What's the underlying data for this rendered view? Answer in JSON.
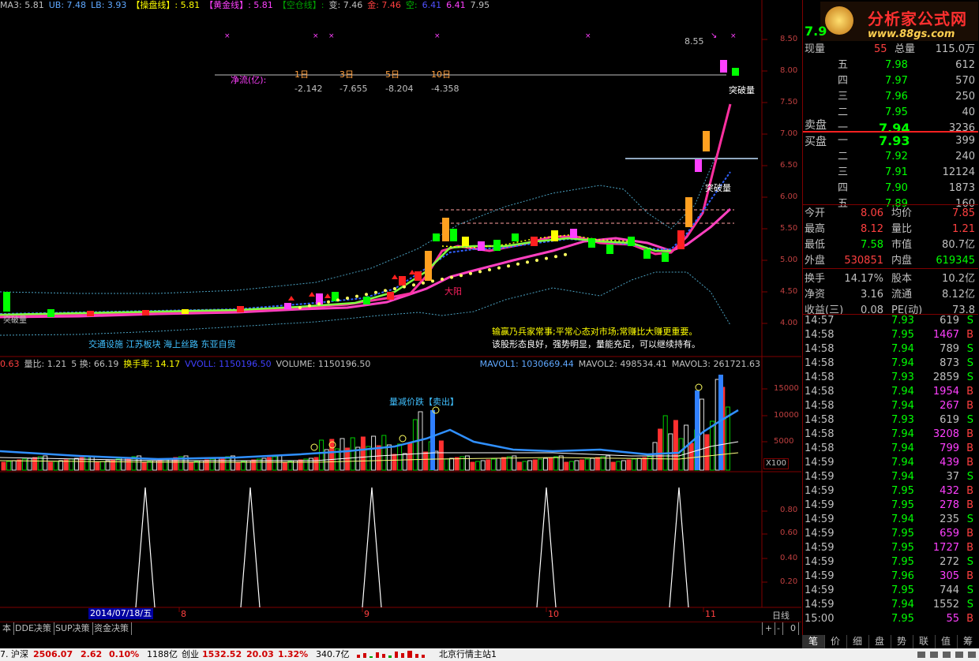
{
  "indicator_legend": [
    {
      "text": "MA3: 5.81",
      "color": "#c0c0c0"
    },
    {
      "text": "UB: 7.48",
      "color": "#5fa8ff"
    },
    {
      "text": "LB: 3.93",
      "color": "#5fa8ff"
    },
    {
      "text": "【操盘线】: 5.81",
      "color": "#ffff00"
    },
    {
      "text": "【黄金线】: 5.81",
      "color": "#ff40ff"
    },
    {
      "text": "【空仓线】:",
      "color": "#00a000"
    },
    {
      "text": "变: 7.46",
      "color": "#c0c0c0"
    },
    {
      "text": "金: 7.46",
      "color": "#ff4040"
    },
    {
      "text": "空:",
      "color": "#00c000"
    },
    {
      "text": "6.41",
      "color": "#5050ff"
    },
    {
      "text": "6.41",
      "color": "#ff40ff"
    },
    {
      "text": "7.95",
      "color": "#c0c0c0"
    }
  ],
  "net_flow": {
    "label": "净流(亿):",
    "periods": [
      "1日",
      "3日",
      "5日",
      "10日"
    ],
    "values": [
      "-2.142",
      "-7.655",
      "-8.204",
      "-4.358"
    ]
  },
  "price_axis": [
    "8.50",
    "8.00",
    "7.50",
    "7.00",
    "6.50",
    "6.00",
    "5.50",
    "5.00",
    "4.50",
    "4.00"
  ],
  "annotations": {
    "peak": "8.55",
    "breakout1": "突破量",
    "breakout2": "突破量",
    "big_yang": "大阳",
    "tags": "交通设施 江苏板块 海上丝路 东亚自贸",
    "comment1": "输赢乃兵家常事;平常心态对市场;常赚比大赚更重要。",
    "comment2": "该股形态良好，强势明显，量能充足，可以继续持有。",
    "sell_signal": "量减价跌【卖出】",
    "left_label": "突破量"
  },
  "volume_legend": [
    {
      "text": "0.63",
      "color": "#ff4040"
    },
    {
      "text": "量比: 1.21",
      "color": "#c0c0c0"
    },
    {
      "text": "5 换: 66.19",
      "color": "#c0c0c0"
    },
    {
      "text": "换手率: 14.17",
      "color": "#ffff00"
    },
    {
      "text": "VVOLL: 1150196.50",
      "color": "#4040ff"
    },
    {
      "text": "VOLUME: 1150196.50",
      "color": "#c0c0c0"
    }
  ],
  "mavol_legend": [
    {
      "text": "MAVOL1: 1030669.44",
      "color": "#5fa8ff"
    },
    {
      "text": "MAVOL2: 498534.41",
      "color": "#c0c0c0"
    },
    {
      "text": "MAVOL3: 261721.63",
      "color": "#c0c0c0"
    }
  ],
  "volume_axis": [
    "15000",
    "10000",
    "5000"
  ],
  "volume_unit": "X100",
  "osc_axis": [
    "0.80",
    "0.60",
    "0.40",
    "0.20"
  ],
  "date_axis": {
    "selected": "2014/07/18/五",
    "months": [
      "8",
      "9",
      "10",
      "11"
    ],
    "period": "日线"
  },
  "bottom_tabs": [
    "本",
    "DDE决策",
    "SUP决策",
    "资金决策"
  ],
  "scroll_controls": [
    "+",
    "-",
    "0"
  ],
  "logo": {
    "title": "分析家公式网",
    "url": "www.88gs.com"
  },
  "quote": {
    "code_price": "7.9",
    "now_label": "现量",
    "now_val": "55",
    "total_label": "总量",
    "total_val": "115.0万",
    "sell": [
      {
        "label": "五",
        "price": "7.98",
        "vol": "612"
      },
      {
        "label": "四",
        "price": "7.97",
        "vol": "570"
      },
      {
        "label": "三",
        "price": "7.96",
        "vol": "250"
      },
      {
        "label": "二",
        "price": "7.95",
        "vol": "40"
      },
      {
        "label": "一",
        "price": "7.94",
        "vol": "3236"
      }
    ],
    "sell_title": "卖盘",
    "buy_title": "买盘",
    "buy": [
      {
        "label": "一",
        "price": "7.93",
        "vol": "399"
      },
      {
        "label": "二",
        "price": "7.92",
        "vol": "240"
      },
      {
        "label": "三",
        "price": "7.91",
        "vol": "12124"
      },
      {
        "label": "四",
        "price": "7.90",
        "vol": "1873"
      },
      {
        "label": "五",
        "price": "7.89",
        "vol": "160"
      }
    ],
    "stats": [
      {
        "l1": "今开",
        "v1": "8.06",
        "l2": "均价",
        "v2": "7.85",
        "c1": "#ff4040",
        "c2": "#ff4040"
      },
      {
        "l1": "最高",
        "v1": "8.12",
        "l2": "量比",
        "v2": "1.21",
        "c1": "#ff4040",
        "c2": "#ff4040"
      },
      {
        "l1": "最低",
        "v1": "7.58",
        "l2": "市值",
        "v2": "80.7亿",
        "c1": "#00ff00",
        "c2": "#c0c0c0"
      },
      {
        "l1": "外盘",
        "v1": "530851",
        "l2": "内盘",
        "v2": "619345",
        "c1": "#ff4040",
        "c2": "#00ff00"
      },
      {
        "l1": "换手",
        "v1": "14.17%",
        "l2": "股本",
        "v2": "10.2亿",
        "c1": "#c0c0c0",
        "c2": "#c0c0c0"
      },
      {
        "l1": "净资",
        "v1": "3.16",
        "l2": "流通",
        "v2": "8.12亿",
        "c1": "#c0c0c0",
        "c2": "#c0c0c0"
      },
      {
        "l1": "收益(三)",
        "v1": "0.08",
        "l2": "PE(动)",
        "v2": "73.8",
        "c1": "#c0c0c0",
        "c2": "#c0c0c0"
      }
    ]
  },
  "ticks": [
    {
      "t": "14:57",
      "p": "7.93",
      "v": "619",
      "s": "S"
    },
    {
      "t": "14:58",
      "p": "7.95",
      "v": "1467",
      "s": "B"
    },
    {
      "t": "14:58",
      "p": "7.94",
      "v": "789",
      "s": "S"
    },
    {
      "t": "14:58",
      "p": "7.94",
      "v": "873",
      "s": "S"
    },
    {
      "t": "14:58",
      "p": "7.93",
      "v": "2859",
      "s": "S"
    },
    {
      "t": "14:58",
      "p": "7.94",
      "v": "1954",
      "s": "B"
    },
    {
      "t": "14:58",
      "p": "7.94",
      "v": "267",
      "s": "B"
    },
    {
      "t": "14:58",
      "p": "7.93",
      "v": "619",
      "s": "S"
    },
    {
      "t": "14:58",
      "p": "7.94",
      "v": "3208",
      "s": "B"
    },
    {
      "t": "14:58",
      "p": "7.94",
      "v": "799",
      "s": "B"
    },
    {
      "t": "14:59",
      "p": "7.94",
      "v": "439",
      "s": "B"
    },
    {
      "t": "14:59",
      "p": "7.94",
      "v": "37",
      "s": "S"
    },
    {
      "t": "14:59",
      "p": "7.95",
      "v": "432",
      "s": "B"
    },
    {
      "t": "14:59",
      "p": "7.95",
      "v": "278",
      "s": "B"
    },
    {
      "t": "14:59",
      "p": "7.94",
      "v": "235",
      "s": "S"
    },
    {
      "t": "14:59",
      "p": "7.95",
      "v": "659",
      "s": "B"
    },
    {
      "t": "14:59",
      "p": "7.95",
      "v": "1727",
      "s": "B"
    },
    {
      "t": "14:59",
      "p": "7.95",
      "v": "272",
      "s": "S"
    },
    {
      "t": "14:59",
      "p": "7.96",
      "v": "305",
      "s": "B"
    },
    {
      "t": "14:59",
      "p": "7.95",
      "v": "744",
      "s": "S"
    },
    {
      "t": "14:59",
      "p": "7.94",
      "v": "1552",
      "s": "S"
    },
    {
      "t": "15:00",
      "p": "7.95",
      "v": "55",
      "s": "B"
    }
  ],
  "right_tabs": [
    "笔",
    "价",
    "细",
    "盘",
    "势",
    "联",
    "值",
    "筹"
  ],
  "status": {
    "prefix": "7.",
    "sh_label": "沪深",
    "sh_val": "2506.07",
    "sh_chg": "2.62",
    "sh_pct": "0.10%",
    "sh_amt": "1188亿",
    "cy_label": "创业",
    "cy_val": "1532.52",
    "cy_chg": "20.03",
    "cy_pct": "1.32%",
    "cy_amt": "340.7亿",
    "server": "北京行情主站1"
  },
  "colors": {
    "up": "#ff4040",
    "down": "#00ff00",
    "axis": "#800000",
    "bg": "#000000"
  }
}
